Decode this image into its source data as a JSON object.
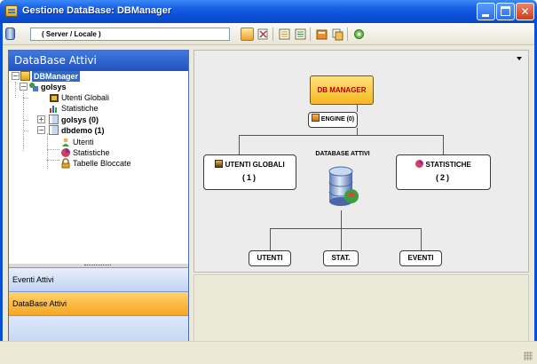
{
  "window": {
    "title": "Gestione DataBase: DBManager",
    "minimize_icon": "minimize-icon",
    "maximize_icon": "maximize-icon",
    "close_label": "✕"
  },
  "toolbar": {
    "server_combo_value": "( Server / Locale )",
    "buttons": [
      "open-icon",
      "clear-icon",
      "list-icon",
      "list-alt-icon",
      "properties-icon",
      "copy-icon",
      "refresh-icon"
    ]
  },
  "sidebar": {
    "header": "DataBase Attivi",
    "tree": {
      "root": "DBManager",
      "server": "golsys",
      "users_global": "Utenti Globali",
      "stats": "Statistiche",
      "db_golsys": "golsys (0)",
      "db_dbdemo": "dbdemo (1)",
      "db_users": "Utenti",
      "db_stats": "Statistiche",
      "db_locked_tables": "Tabelle Bloccate"
    },
    "nav": {
      "events": "Eventi Attivi",
      "databases": "DataBase Attivi",
      "more_icon": "chevron-down-icon"
    }
  },
  "diagram": {
    "root": "DB MANAGER",
    "engine": "ENGINE (0)",
    "global_users": "UTENTI GLOBALI",
    "global_users_count": "(1)",
    "active_db": "DATABASE ATTIVI",
    "statistics": "STATISTICHE",
    "statistics_count": "(2)",
    "users": "UTENTI",
    "stats_short": "STAT.",
    "events": "EVENTI"
  },
  "colors": {
    "title_bar": "#0a4fd8",
    "root_node": "#f5b820",
    "root_text": "#b00000",
    "nav_selected": "#f6a623"
  }
}
